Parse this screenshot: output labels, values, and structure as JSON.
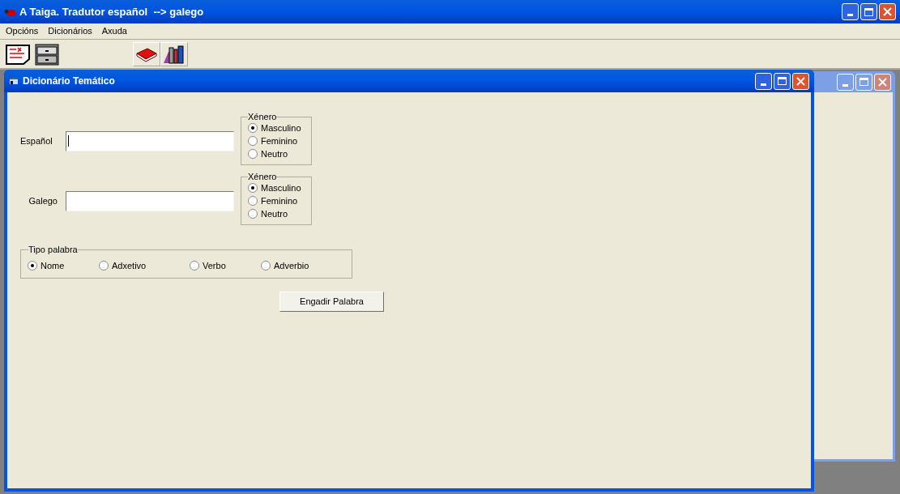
{
  "window": {
    "title": "A Taiga. Tradutor español  --> galego"
  },
  "menu": [
    "Opcións",
    "Dicionários",
    "Axuda"
  ],
  "child_window": {
    "title": "Dicionário Temático"
  },
  "fields": [
    {
      "label": "Español",
      "focused": true,
      "gender": {
        "title": "Xénero",
        "options": [
          {
            "label": "Masculino",
            "selected": true
          },
          {
            "label": "Feminino",
            "selected": false
          },
          {
            "label": "Neutro",
            "selected": false
          }
        ]
      }
    },
    {
      "label": "Galego",
      "focused": false,
      "gender": {
        "title": "Xénero",
        "options": [
          {
            "label": "Masculino",
            "selected": true
          },
          {
            "label": "Feminino",
            "selected": false
          },
          {
            "label": "Neutro",
            "selected": false
          }
        ]
      }
    }
  ],
  "word_type": {
    "title": "Tipo palabra",
    "options": [
      {
        "label": "Nome",
        "selected": true
      },
      {
        "label": "Adxetivo",
        "selected": false
      },
      {
        "label": "Verbo",
        "selected": false
      },
      {
        "label": "Adverbio",
        "selected": false
      }
    ]
  },
  "button": "Engadir Palabra"
}
